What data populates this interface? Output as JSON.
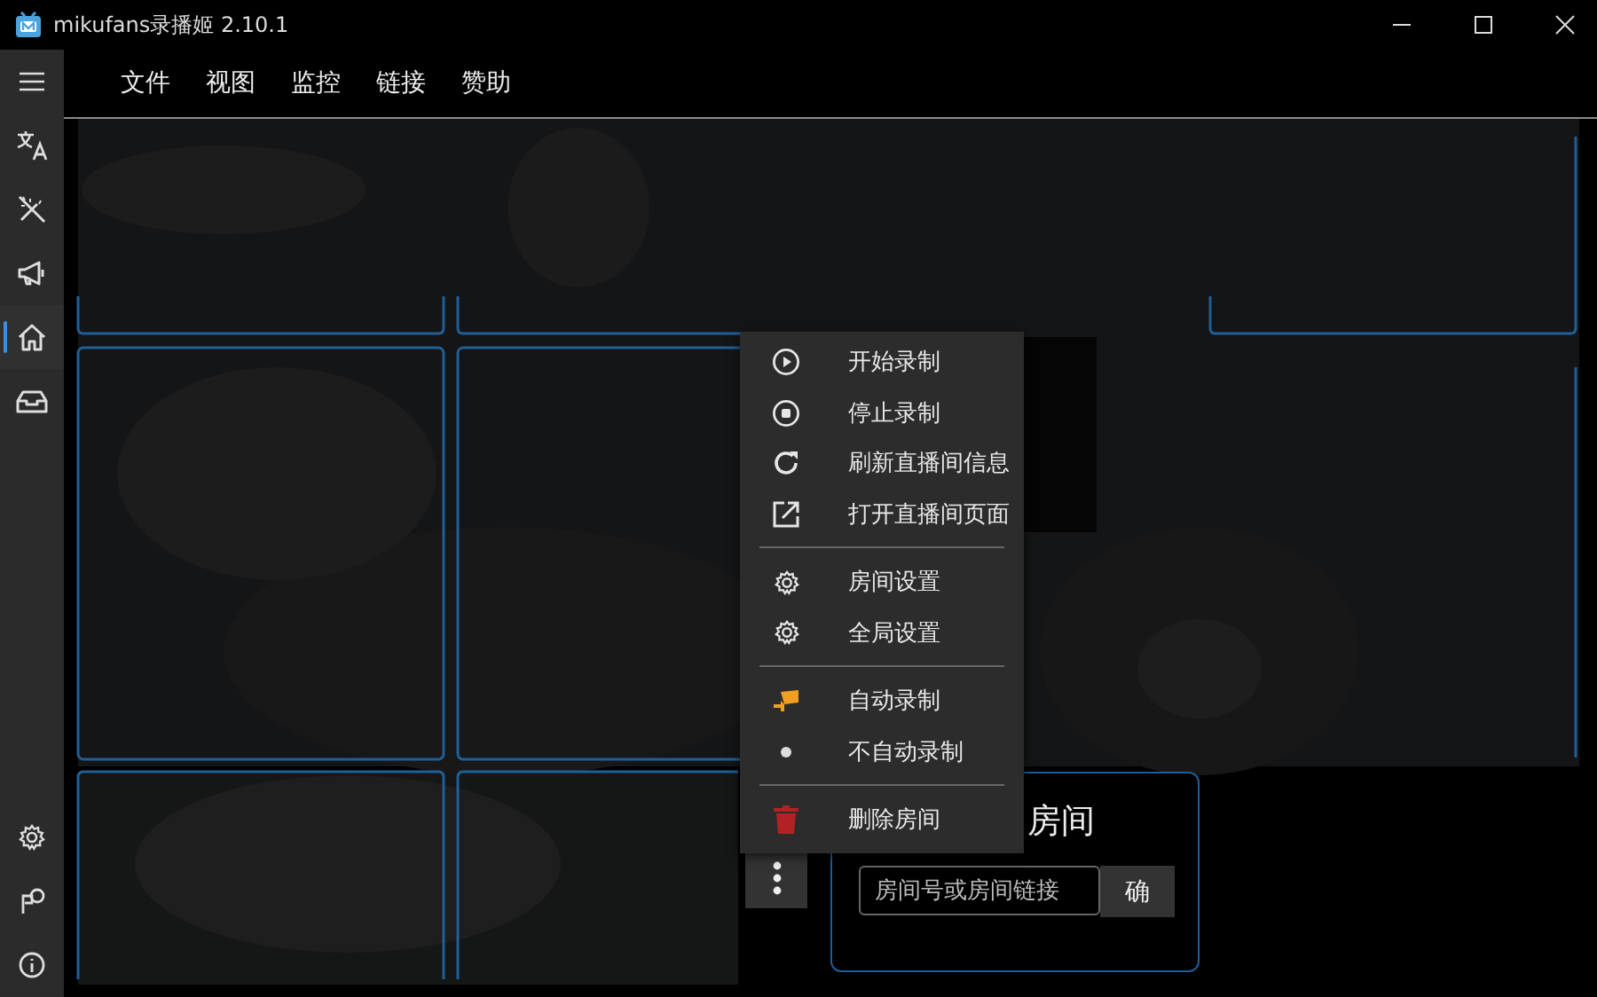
{
  "window": {
    "title": "mikufans录播姬 2.10.1"
  },
  "sidebar": {
    "items": [
      {
        "selected": false
      },
      {
        "selected": false
      },
      {
        "selected": false
      },
      {
        "selected": false
      },
      {
        "selected": true
      },
      {
        "selected": false
      }
    ],
    "bottom_items": [
      {
        "selected": false
      },
      {
        "selected": false
      },
      {
        "selected": false
      }
    ]
  },
  "menu_bar": [
    "文件",
    "视图",
    "监控",
    "链接",
    "赞助"
  ],
  "context_menu": {
    "groups": [
      {
        "items": [
          {
            "label": "开始录制",
            "kind": "action"
          },
          {
            "label": "停止录制",
            "kind": "action"
          },
          {
            "label": "刷新直播间信息",
            "kind": "action"
          },
          {
            "label": "打开直播间页面",
            "kind": "action"
          }
        ]
      },
      {
        "items": [
          {
            "label": "房间设置",
            "kind": "action"
          },
          {
            "label": "全局设置",
            "kind": "action"
          }
        ]
      },
      {
        "items": [
          {
            "label": "自动录制",
            "kind": "radio",
            "selected": false
          },
          {
            "label": "不自动录制",
            "kind": "radio",
            "selected": true
          }
        ]
      },
      {
        "items": [
          {
            "label": "删除房间",
            "kind": "danger"
          }
        ]
      }
    ]
  },
  "add_room": {
    "title": "房间",
    "input": {
      "placeholder": "房间号或房间链接"
    },
    "button": "确"
  }
}
